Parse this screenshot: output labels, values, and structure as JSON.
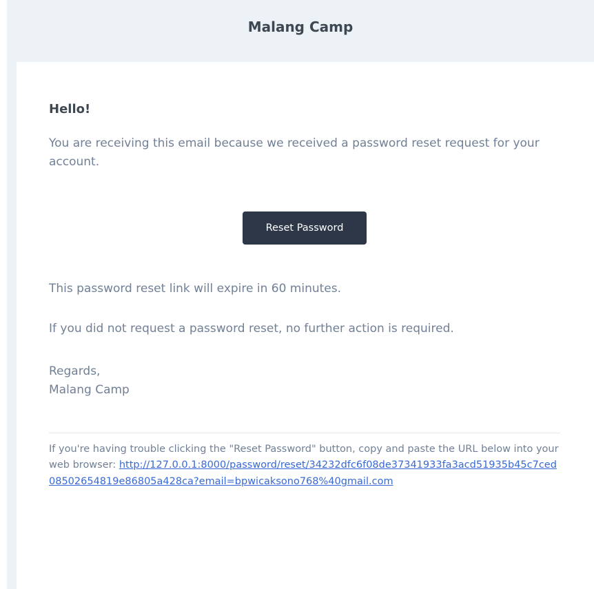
{
  "header": {
    "title": "Malang Camp"
  },
  "email": {
    "greeting": "Hello!",
    "intro": "You are receiving this email because we received a password reset request for your account.",
    "button_label": "Reset Password",
    "expire_line": "This password reset link will expire in 60 minutes.",
    "no_action_line": "If you did not request a password reset, no further action is required.",
    "regards": "Regards,",
    "signature": "Malang Camp"
  },
  "subcopy": {
    "text": "If you're having trouble clicking the \"Reset Password\" button, copy and paste the URL below into your web browser: ",
    "link": "http://127.0.0.1:8000/password/reset/34232dfc6f08de37341933fa3acd51935b45c7ced08502654819e86805a428ca?email=bpwicaksono768%40gmail.com"
  },
  "colors": {
    "background": "#edf2f7",
    "card": "#ffffff",
    "button": "#2d3748",
    "link": "#3869d4",
    "heading": "#3d4852",
    "body_text": "#718096"
  }
}
